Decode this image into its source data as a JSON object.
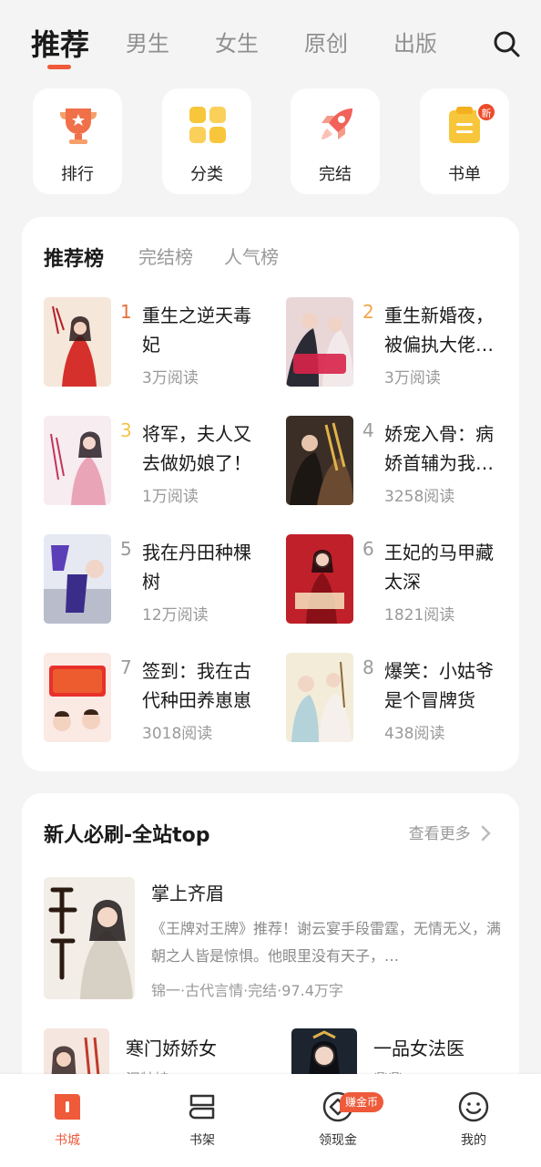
{
  "top_tabs": [
    "推荐",
    "男生",
    "女生",
    "原创",
    "出版"
  ],
  "quick_entries": [
    {
      "label": "排行",
      "icon": "trophy-icon"
    },
    {
      "label": "分类",
      "icon": "grid-icon"
    },
    {
      "label": "完结",
      "icon": "rocket-icon"
    },
    {
      "label": "书单",
      "icon": "booklist-icon",
      "badge": "新"
    }
  ],
  "ranking": {
    "tabs": [
      "推荐榜",
      "完结榜",
      "人气榜"
    ],
    "books": [
      {
        "rank": "1",
        "title": "重生之逆天毒妃",
        "reads": "3万阅读"
      },
      {
        "rank": "2",
        "title": "重生新婚夜，被偏执大佬…",
        "reads": "3万阅读"
      },
      {
        "rank": "3",
        "title": "将军，夫人又去做奶娘了！",
        "reads": "1万阅读"
      },
      {
        "rank": "4",
        "title": "娇宠入骨：病娇首辅为我…",
        "reads": "3258阅读"
      },
      {
        "rank": "5",
        "title": "我在丹田种棵树",
        "reads": "12万阅读"
      },
      {
        "rank": "6",
        "title": "王妃的马甲藏太深",
        "reads": "1821阅读"
      },
      {
        "rank": "7",
        "title": "签到：我在古代种田养崽崽",
        "reads": "3018阅读"
      },
      {
        "rank": "8",
        "title": "爆笑：小姑爷是个冒牌货",
        "reads": "438阅读"
      }
    ]
  },
  "new_section": {
    "title": "新人必刷-全站top",
    "more": "查看更多",
    "featured": {
      "title": "掌上齐眉",
      "desc": "《王牌对王牌》推荐！谢云宴手段雷霆，无情无义，满朝之人皆是惊惧。他眼里没有天子，…",
      "meta": "锦一·古代言情·完结·97.4万字"
    },
    "small_books": [
      {
        "title": "寒门娇娇女",
        "author": "泥牡娃"
      },
      {
        "title": "一品女法医",
        "author": "鼎鼎"
      }
    ]
  },
  "bottom_nav": [
    {
      "label": "书城",
      "icon": "bookstore-icon"
    },
    {
      "label": "书架",
      "icon": "bookshelf-icon"
    },
    {
      "label": "领现金",
      "icon": "cash-icon",
      "badge": "赚金币"
    },
    {
      "label": "我的",
      "icon": "smiley-icon"
    }
  ],
  "colors": {
    "accent": "#ee5a3a",
    "bg": "#f4f4f4"
  }
}
